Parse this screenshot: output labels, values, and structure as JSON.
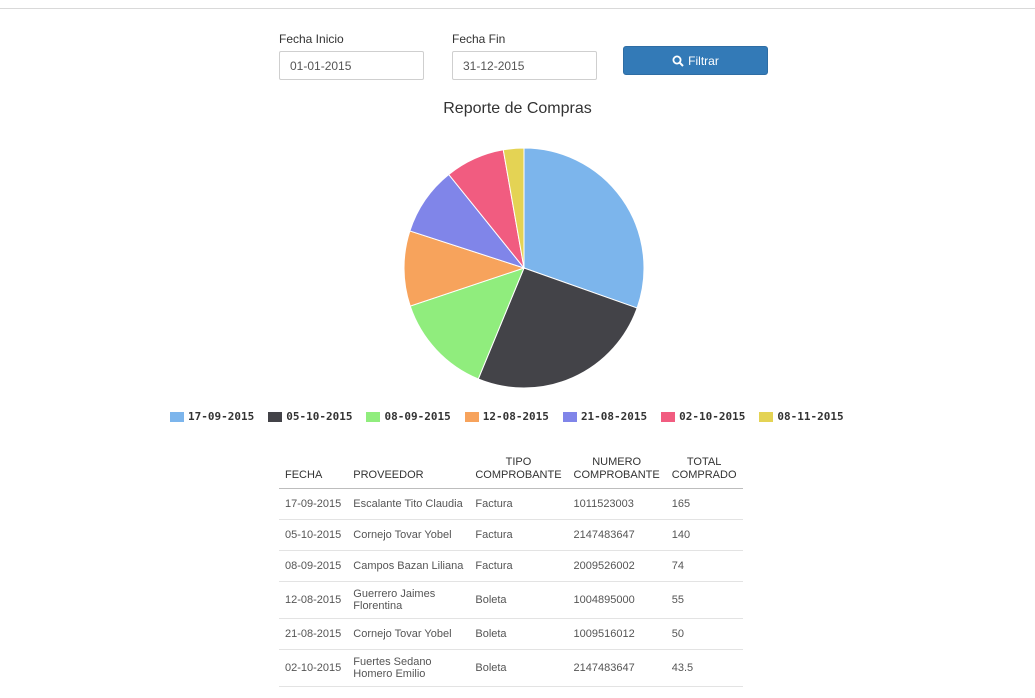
{
  "filters": {
    "start_label": "Fecha Inicio",
    "start_value": "01-01-2015",
    "end_label": "Fecha Fin",
    "end_value": "31-12-2015",
    "filter_button": "Filtrar",
    "filter_icon": "search-icon"
  },
  "chart_data": {
    "type": "pie",
    "title": "Reporte de Compras",
    "categories": [
      "17-09-2015",
      "05-10-2015",
      "08-09-2015",
      "12-08-2015",
      "21-08-2015",
      "02-10-2015",
      "08-11-2015"
    ],
    "values": [
      165,
      140,
      74,
      55,
      50,
      43.5,
      15
    ],
    "colors": [
      "#7cb5ec",
      "#434348",
      "#90ed7d",
      "#f7a35c",
      "#8085e9",
      "#f15c80",
      "#e4d354"
    ],
    "legend_position": "bottom"
  },
  "table": {
    "headers": [
      [
        "FECHA"
      ],
      [
        "PROVEEDOR"
      ],
      [
        "TIPO",
        "COMPROBANTE"
      ],
      [
        "NUMERO",
        "COMPROBANTE"
      ],
      [
        "TOTAL",
        "COMPRADO"
      ]
    ],
    "rows": [
      [
        "17-09-2015",
        [
          "Escalante Tito Claudia"
        ],
        "Factura",
        "1011523003",
        "165"
      ],
      [
        "05-10-2015",
        [
          "Cornejo Tovar Yobel"
        ],
        "Factura",
        "2147483647",
        "140"
      ],
      [
        "08-09-2015",
        [
          "Campos Bazan Liliana"
        ],
        "Factura",
        "2009526002",
        "74"
      ],
      [
        "12-08-2015",
        [
          "Guerrero Jaimes",
          "Florentina"
        ],
        "Boleta",
        "1004895000",
        "55"
      ],
      [
        "21-08-2015",
        [
          "Cornejo Tovar Yobel"
        ],
        "Boleta",
        "1009516012",
        "50"
      ],
      [
        "02-10-2015",
        [
          "Fuertes Sedano",
          "Homero Emilio"
        ],
        "Boleta",
        "2147483647",
        "43.5"
      ]
    ]
  }
}
